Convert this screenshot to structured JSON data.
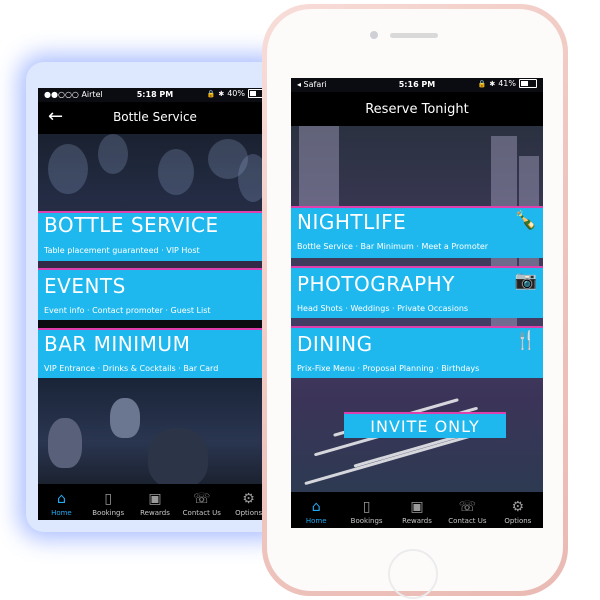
{
  "left_phone": {
    "status": {
      "carrier": "●●○○○ Airtel",
      "time": "5:18 PM",
      "battery": "40%",
      "battery_level": 0.4
    },
    "nav": {
      "title": "Bottle Service",
      "back_icon": "back-arrow-icon"
    },
    "menu": [
      {
        "title": "BOTTLE SERVICE",
        "subtitle": "Table placement guaranteed · VIP Host"
      },
      {
        "title": "EVENTS",
        "subtitle": "Event info · Contact promoter · Guest List"
      },
      {
        "title": "BAR MINIMUM",
        "subtitle": "VIP Entrance · Drinks & Cocktails · Bar Card"
      }
    ],
    "tabs": [
      {
        "label": "Home",
        "icon": "home-icon",
        "active": true
      },
      {
        "label": "Bookings",
        "icon": "bookmark-icon",
        "active": false
      },
      {
        "label": "Rewards",
        "icon": "gift-icon",
        "active": false
      },
      {
        "label": "Contact Us",
        "icon": "phone-icon",
        "active": false
      },
      {
        "label": "Options",
        "icon": "gear-icon",
        "active": false
      }
    ]
  },
  "right_phone": {
    "status": {
      "carrier": "◂ Safari",
      "time": "5:16 PM",
      "battery": "41%",
      "battery_level": 0.41
    },
    "nav": {
      "title": "Reserve Tonight"
    },
    "menu": [
      {
        "title": "NIGHTLIFE",
        "subtitle": "Bottle Service · Bar Minimum · Meet a Promoter",
        "icon": "bottle-glass-icon"
      },
      {
        "title": "PHOTOGRAPHY",
        "subtitle": "Head Shots · Weddings · Private Occasions",
        "icon": "camera-icon"
      },
      {
        "title": "DINING",
        "subtitle": "Prix-Fixe Menu · Proposal Planning · Birthdays",
        "icon": "fork-wine-icon"
      }
    ],
    "invite_label": "INVITE ONLY",
    "tabs": [
      {
        "label": "Home",
        "icon": "home-icon",
        "active": true
      },
      {
        "label": "Bookings",
        "icon": "bookmark-icon",
        "active": false
      },
      {
        "label": "Rewards",
        "icon": "gift-icon",
        "active": false
      },
      {
        "label": "Contact Us",
        "icon": "phone-icon",
        "active": false
      },
      {
        "label": "Options",
        "icon": "gear-icon",
        "active": false
      }
    ]
  },
  "colors": {
    "accent": "#1fb8ee",
    "border_accent": "#e03fae",
    "tab_active": "#23a9f2",
    "bar_bg": "#000000"
  }
}
